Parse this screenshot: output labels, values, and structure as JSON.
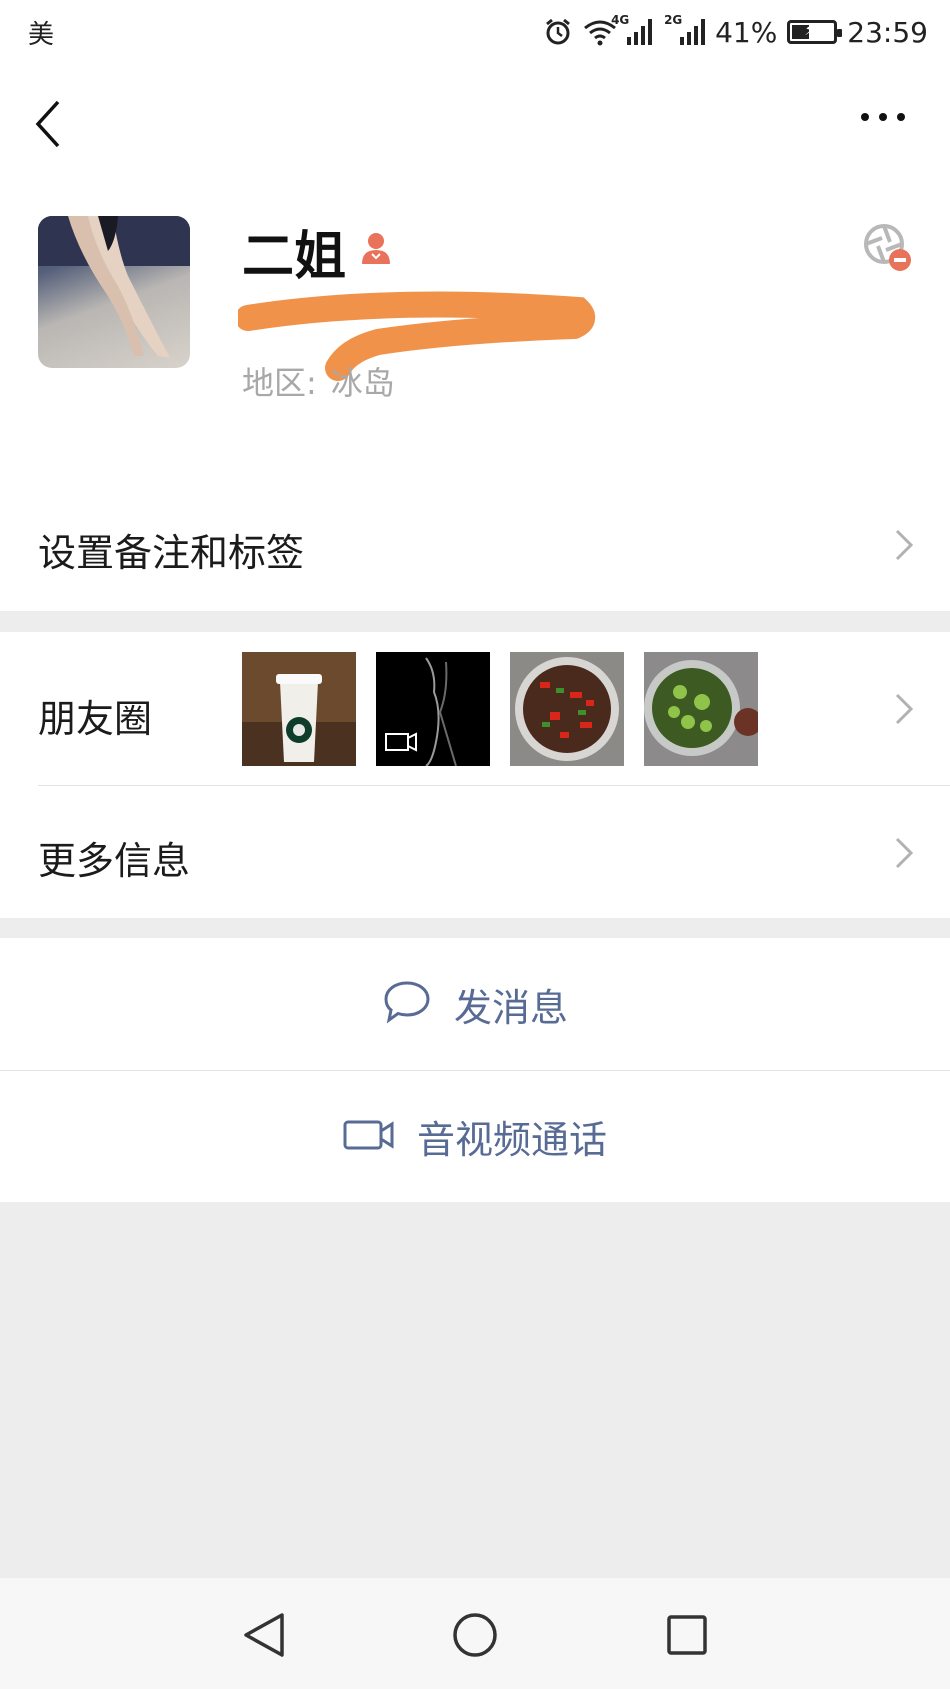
{
  "status_bar": {
    "carrier": "美",
    "net1": "4G",
    "net2": "2G",
    "battery_percent": "41%",
    "battery_level": 0.41,
    "time": "23:59"
  },
  "nav": {
    "back_icon": "chevron-left-icon",
    "more_icon": "ellipsis-icon"
  },
  "profile": {
    "name": "二姐",
    "gender_icon": "female-icon",
    "region_label": "地区:",
    "region_value": "冰岛",
    "shutter_icon": "moments-blocked-icon"
  },
  "rows": {
    "remark": "设置备注和标签",
    "moments": "朋友圈",
    "more_info": "更多信息"
  },
  "moments_thumbs": [
    {
      "name": "coffee-cup-photo"
    },
    {
      "name": "video-thumb-dark",
      "badge_icon": "video-icon"
    },
    {
      "name": "food-peppers-photo"
    },
    {
      "name": "food-broccoli-photo"
    }
  ],
  "actions": {
    "message": "发消息",
    "message_icon": "chat-bubble-icon",
    "call": "音视频通话",
    "call_icon": "video-camera-icon"
  },
  "colors": {
    "link": "#576b95",
    "redaction": "#f0924a",
    "gender": "#e8735a"
  },
  "system_nav": [
    "back-triangle-icon",
    "home-circle-icon",
    "recents-square-icon"
  ]
}
